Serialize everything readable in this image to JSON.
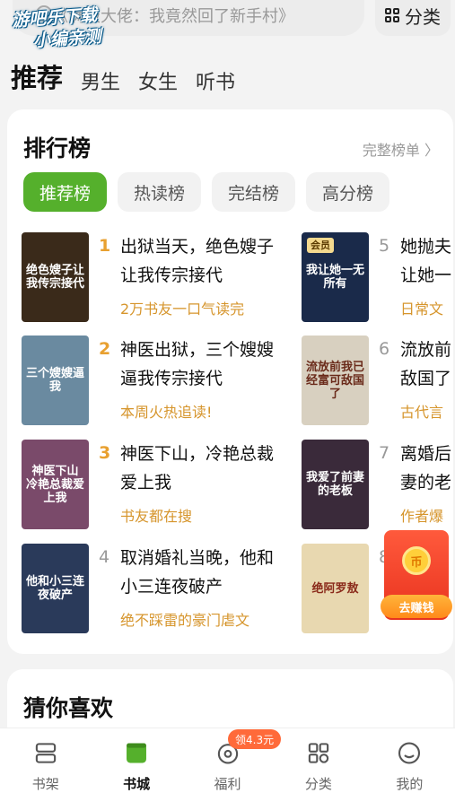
{
  "search": {
    "placeholder": "《满级大佬：我竟然回了新手村》"
  },
  "watermark": {
    "line1": "游吧乐下载",
    "line2": "小编亲测"
  },
  "category_button": {
    "label": "分类",
    "icon": "grid-icon"
  },
  "channels": [
    {
      "label": "推荐",
      "active": true
    },
    {
      "label": "男生"
    },
    {
      "label": "女生"
    },
    {
      "label": "听书"
    }
  ],
  "ranking": {
    "title": "排行榜",
    "more": "完整榜单 〉",
    "tabs": [
      {
        "label": "推荐榜",
        "active": true
      },
      {
        "label": "热读榜"
      },
      {
        "label": "完结榜"
      },
      {
        "label": "高分榜"
      }
    ],
    "books": [
      {
        "rank": "1",
        "title": "出狱当天，绝色嫂子让我传宗接代",
        "tag": "2万书友一口气读完",
        "cover_text": "绝色嫂子让我传宗接代",
        "cover_color": "#3a2a1a"
      },
      {
        "rank": "2",
        "title": "神医出狱，三个嫂嫂逼我传宗接代",
        "tag": "本周火热追读!",
        "cover_text": "三个嫂嫂逼我",
        "cover_color": "#6a8aa0"
      },
      {
        "rank": "3",
        "title": "神医下山，冷艳总裁爱上我",
        "tag": "书友都在搜",
        "cover_text": "神医下山 冷艳总裁爱上我",
        "cover_color": "#7a4a6a"
      },
      {
        "rank": "4",
        "title": "取消婚礼当晚，他和小三连夜破产",
        "tag": "绝不踩雷的豪门虐文",
        "cover_text": "他和小三连夜破产",
        "cover_color": "#2a3a5a"
      },
      {
        "rank": "5",
        "title": "她抛夫让她一",
        "tag": "日常文",
        "cover_text": "我让她一无所有",
        "cover_color": "#1a2a4a",
        "vip": "会员"
      },
      {
        "rank": "6",
        "title": "流放前敌国了",
        "tag": "古代言",
        "cover_text": "流放前我已经富可敌国了",
        "cover_color": "#d8d0c0"
      },
      {
        "rank": "7",
        "title": "离婚后妻的老",
        "tag": "作者爆",
        "cover_text": "我爱了前妻的老板",
        "cover_color": "#3a2a3a"
      },
      {
        "rank": "8",
        "title": "",
        "tag": "",
        "cover_text": "绝阿罗敖",
        "cover_color": "#e8d8b0"
      }
    ]
  },
  "earn_widget": {
    "label": "去赚钱",
    "coin": "币"
  },
  "guess": {
    "title": "猜你喜欢"
  },
  "bottom_nav": {
    "badge": "领4.3元",
    "items": [
      {
        "label": "书架",
        "icon": "bookshelf-icon"
      },
      {
        "label": "书城",
        "icon": "bookstore-icon",
        "active": true
      },
      {
        "label": "福利",
        "icon": "welfare-icon"
      },
      {
        "label": "分类",
        "icon": "category-icon"
      },
      {
        "label": "我的",
        "icon": "profile-icon"
      }
    ]
  },
  "colors": {
    "accent": "#55b02c",
    "tag": "#d6952c",
    "rank_top": "#e8a030",
    "earn": "#e8321e"
  }
}
